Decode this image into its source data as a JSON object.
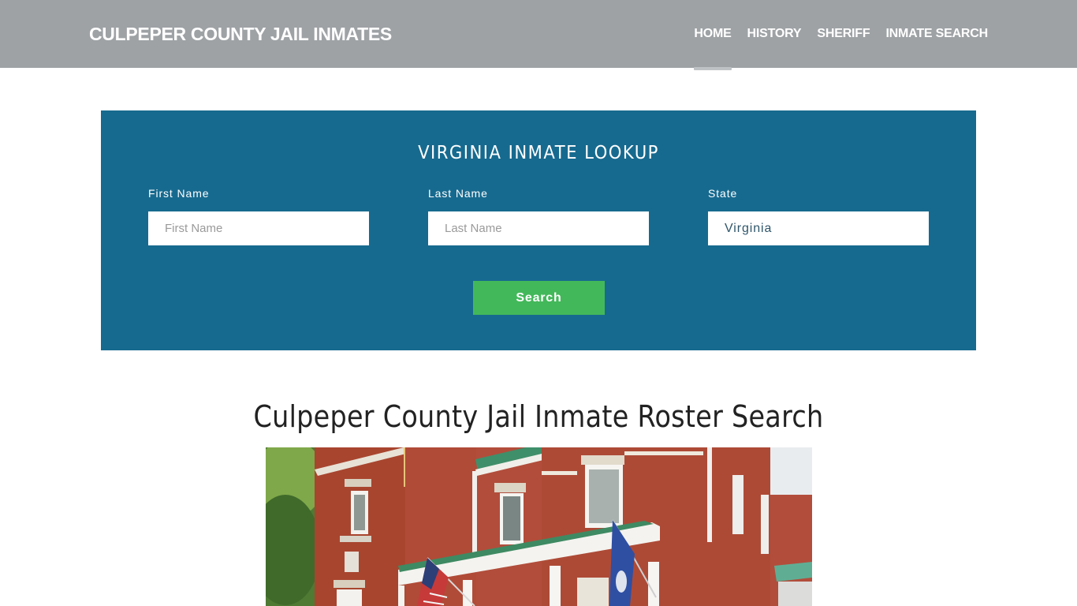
{
  "header": {
    "brand": "CULPEPER COUNTY JAIL INMATES",
    "nav": [
      {
        "label": "HOME",
        "active": true
      },
      {
        "label": "HISTORY",
        "active": false
      },
      {
        "label": "SHERIFF",
        "active": false
      },
      {
        "label": "INMATE SEARCH",
        "active": false
      }
    ]
  },
  "lookup": {
    "title": "VIRGINIA INMATE LOOKUP",
    "first_name": {
      "label": "First Name",
      "placeholder": "First Name",
      "value": ""
    },
    "last_name": {
      "label": "Last Name",
      "placeholder": "Last Name",
      "value": ""
    },
    "state": {
      "label": "State",
      "selected": "Virginia"
    },
    "search_label": "Search"
  },
  "main": {
    "title": "Culpeper County Jail Inmate Roster Search",
    "photo_alt": "Culpeper County Jail building with American and Virginia flags"
  },
  "colors": {
    "header_bg": "#9ea2a5",
    "panel_bg": "#176a8f",
    "button_bg": "#43b85a",
    "nav_active_indicator": "#bfc2c4"
  }
}
